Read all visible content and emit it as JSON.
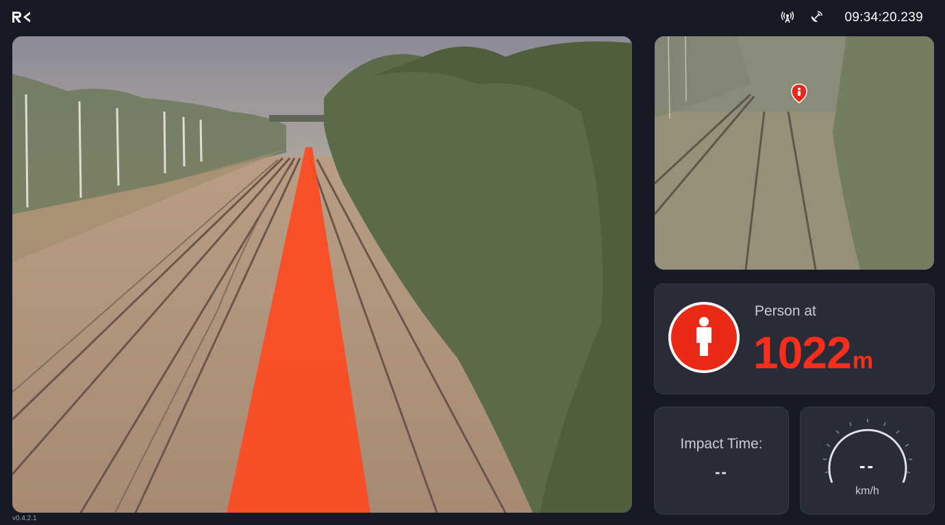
{
  "header": {
    "logo": "R4",
    "signal_icon": "signal-broadcast-icon",
    "connection_icon": "satellite-dish-icon",
    "clock": "09:34:20.239"
  },
  "camera": {
    "main_view": "main-track-camera",
    "secondary_view": "zoom-track-camera",
    "marker_icon": "person-location-pin-icon",
    "track_highlight_color": "#ff4a22"
  },
  "detection": {
    "icon": "person-icon",
    "label": "Person at",
    "distance_value": "1022",
    "distance_unit": "m",
    "alert_color": "#ff2d1a"
  },
  "impact": {
    "label": "Impact Time:",
    "value": "--"
  },
  "speed": {
    "value": "--",
    "unit": "km/h",
    "gauge_icon": "speedometer-gauge-icon"
  },
  "footer": {
    "version": "v0.4.2.1"
  }
}
